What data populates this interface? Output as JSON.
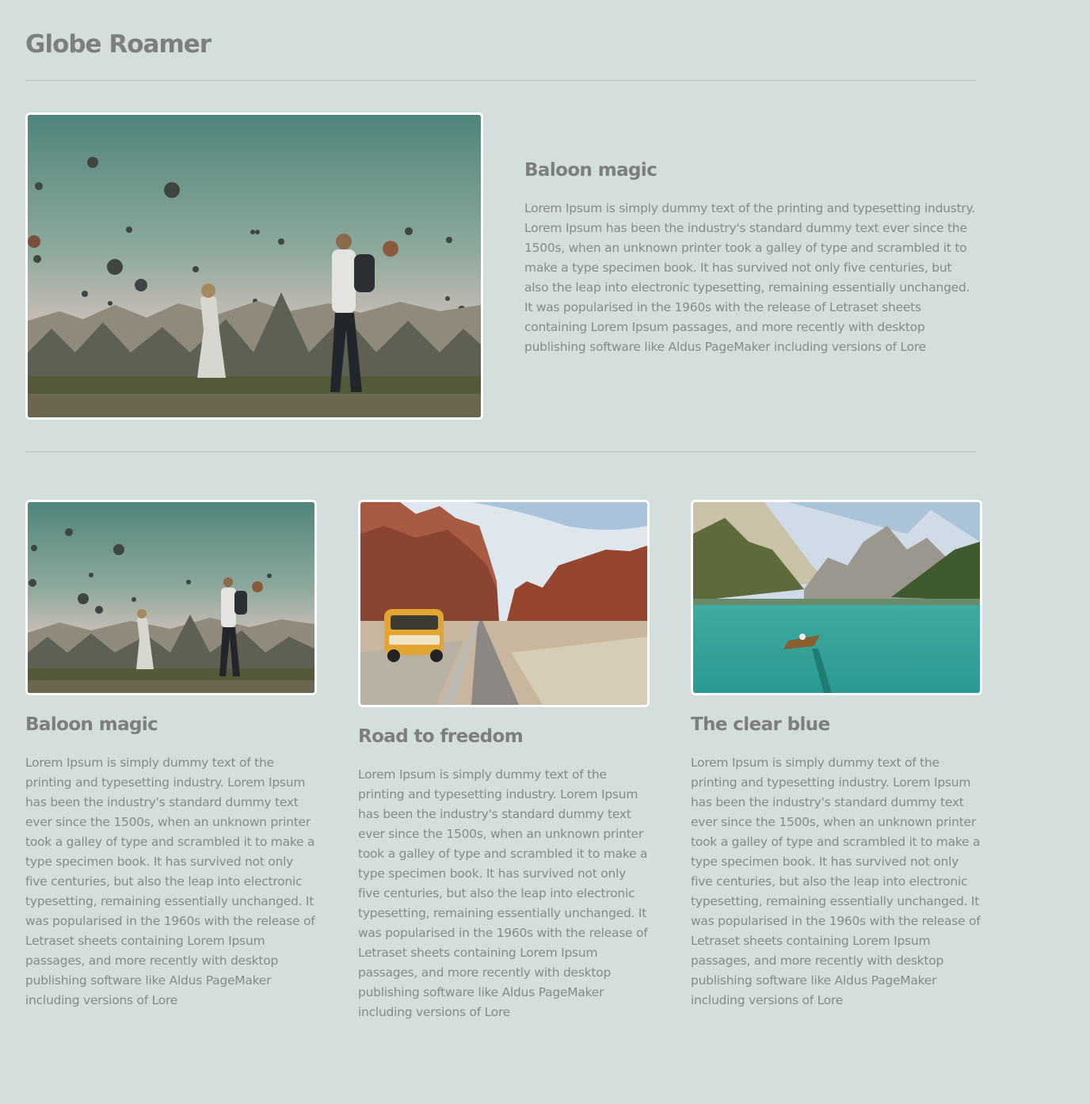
{
  "site": {
    "title": "Globe Roamer"
  },
  "feature": {
    "title": "Baloon magic",
    "body": "Lorem Ipsum is simply dummy text of the printing and typesetting industry. Lorem Ipsum has been the industry's standard dummy text ever since the 1500s, when an unknown printer took a galley of type and scrambled it to make a type specimen book. It has survived not only five centuries, but also the leap into electronic typesetting, remaining essentially unchanged. It was popularised in the 1960s with the release of Letraset sheets containing Lorem Ipsum passages, and more recently with desktop publishing software like Aldus PageMaker including versions of Lore",
    "image": "hot-air-balloons-photo"
  },
  "cards": [
    {
      "title": "Baloon magic",
      "body": "Lorem Ipsum is simply dummy text of the printing and typesetting industry. Lorem Ipsum has been the industry's standard dummy text ever since the 1500s, when an unknown printer took a galley of type and scrambled it to make a type specimen book. It has survived not only five centuries, but also the leap into electronic typesetting, remaining essentially unchanged. It was popularised in the 1960s with the release of Letraset sheets containing Lorem Ipsum passages, and more recently with desktop publishing software like Aldus PageMaker including versions of Lore",
      "image": "hot-air-balloons-photo"
    },
    {
      "title": "Road to freedom",
      "body": "Lorem Ipsum is simply dummy text of the printing and typesetting industry. Lorem Ipsum has been the industry's standard dummy text ever since the 1500s, when an unknown printer took a galley of type and scrambled it to make a type specimen book. It has survived not only five centuries, but also the leap into electronic typesetting, remaining essentially unchanged. It was popularised in the 1960s with the release of Letraset sheets containing Lorem Ipsum passages, and more recently with desktop publishing software like Aldus PageMaker including versions of Lore",
      "image": "desert-road-van-photo"
    },
    {
      "title": "The clear blue",
      "body": "Lorem Ipsum is simply dummy text of the printing and typesetting industry. Lorem Ipsum has been the industry's standard dummy text ever since the 1500s, when an unknown printer took a galley of type and scrambled it to make a type specimen book. It has survived not only five centuries, but also the leap into electronic typesetting, remaining essentially unchanged. It was popularised in the 1960s with the release of Letraset sheets containing Lorem Ipsum passages, and more recently with desktop publishing software like Aldus PageMaker including versions of Lore",
      "image": "mountain-lake-boat-photo"
    }
  ],
  "colors": {
    "background": "#d4dedc",
    "heading": "#7b7f7f",
    "text": "#868a8a",
    "divider": "#b7c0bf",
    "frame": "#ffffff"
  }
}
